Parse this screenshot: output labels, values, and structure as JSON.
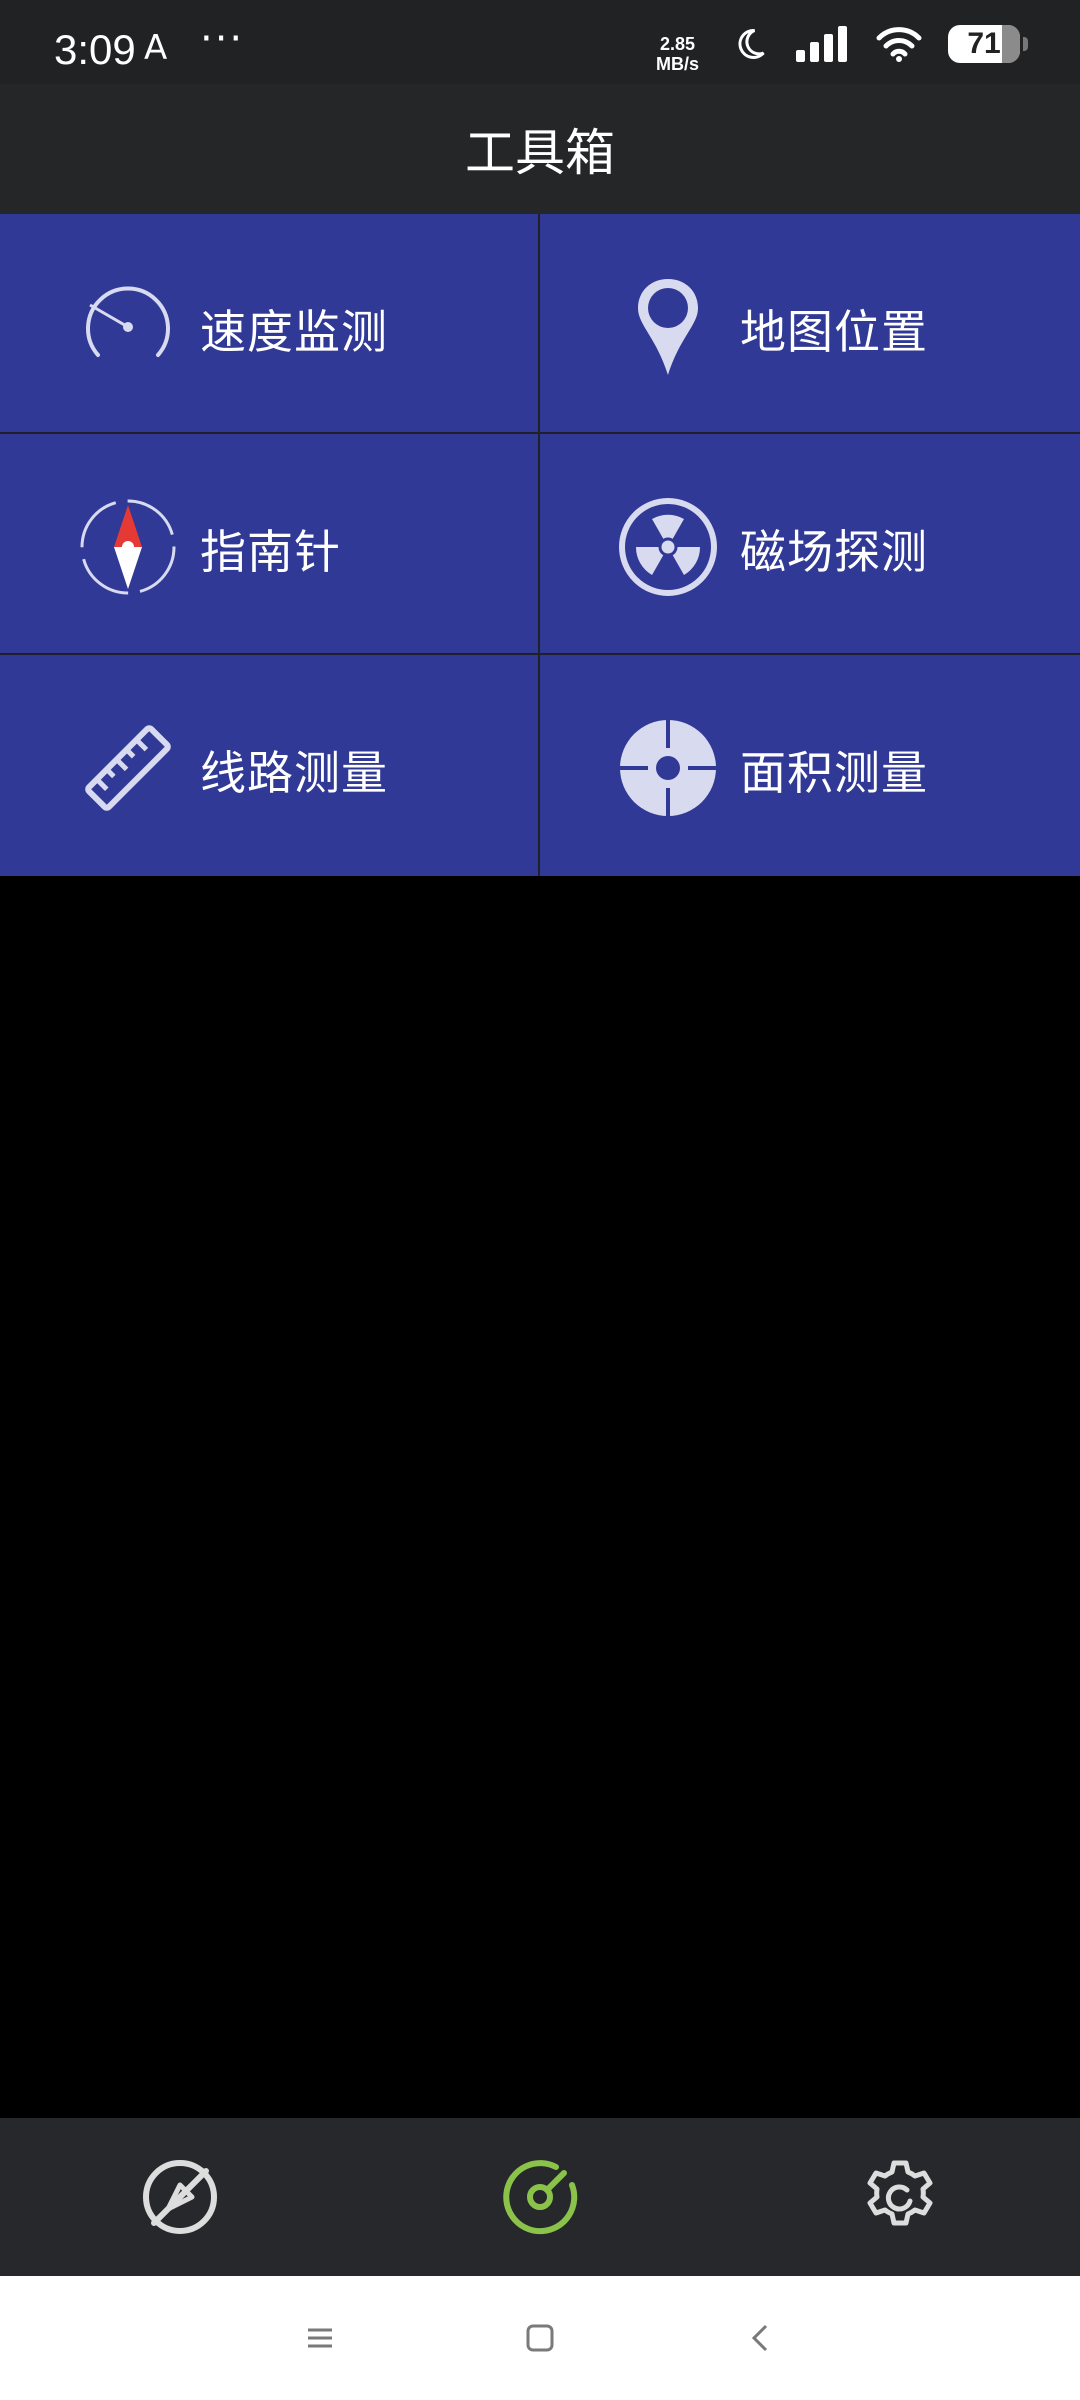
{
  "status": {
    "time": "3:09",
    "a_icon": "A",
    "more": "···",
    "speed_value": "2.85",
    "speed_unit": "MB/s",
    "battery": "71"
  },
  "header": {
    "title": "工具箱"
  },
  "tools": [
    {
      "label": "速度监测",
      "icon": "speedometer-icon"
    },
    {
      "label": "地图位置",
      "icon": "map-pin-icon"
    },
    {
      "label": "指南针",
      "icon": "compass-icon"
    },
    {
      "label": "磁场探测",
      "icon": "radiation-icon"
    },
    {
      "label": "线路测量",
      "icon": "ruler-icon"
    },
    {
      "label": "面积测量",
      "icon": "crosshair-icon"
    }
  ],
  "bottom_nav": [
    {
      "icon": "no-compass-icon",
      "active": false
    },
    {
      "icon": "gauge-icon",
      "active": true
    },
    {
      "icon": "settings-icon",
      "active": false
    }
  ],
  "colors": {
    "tile_bg": "#303995",
    "active_nav": "#8bc34a",
    "icon_fill": "#d8daf0"
  }
}
